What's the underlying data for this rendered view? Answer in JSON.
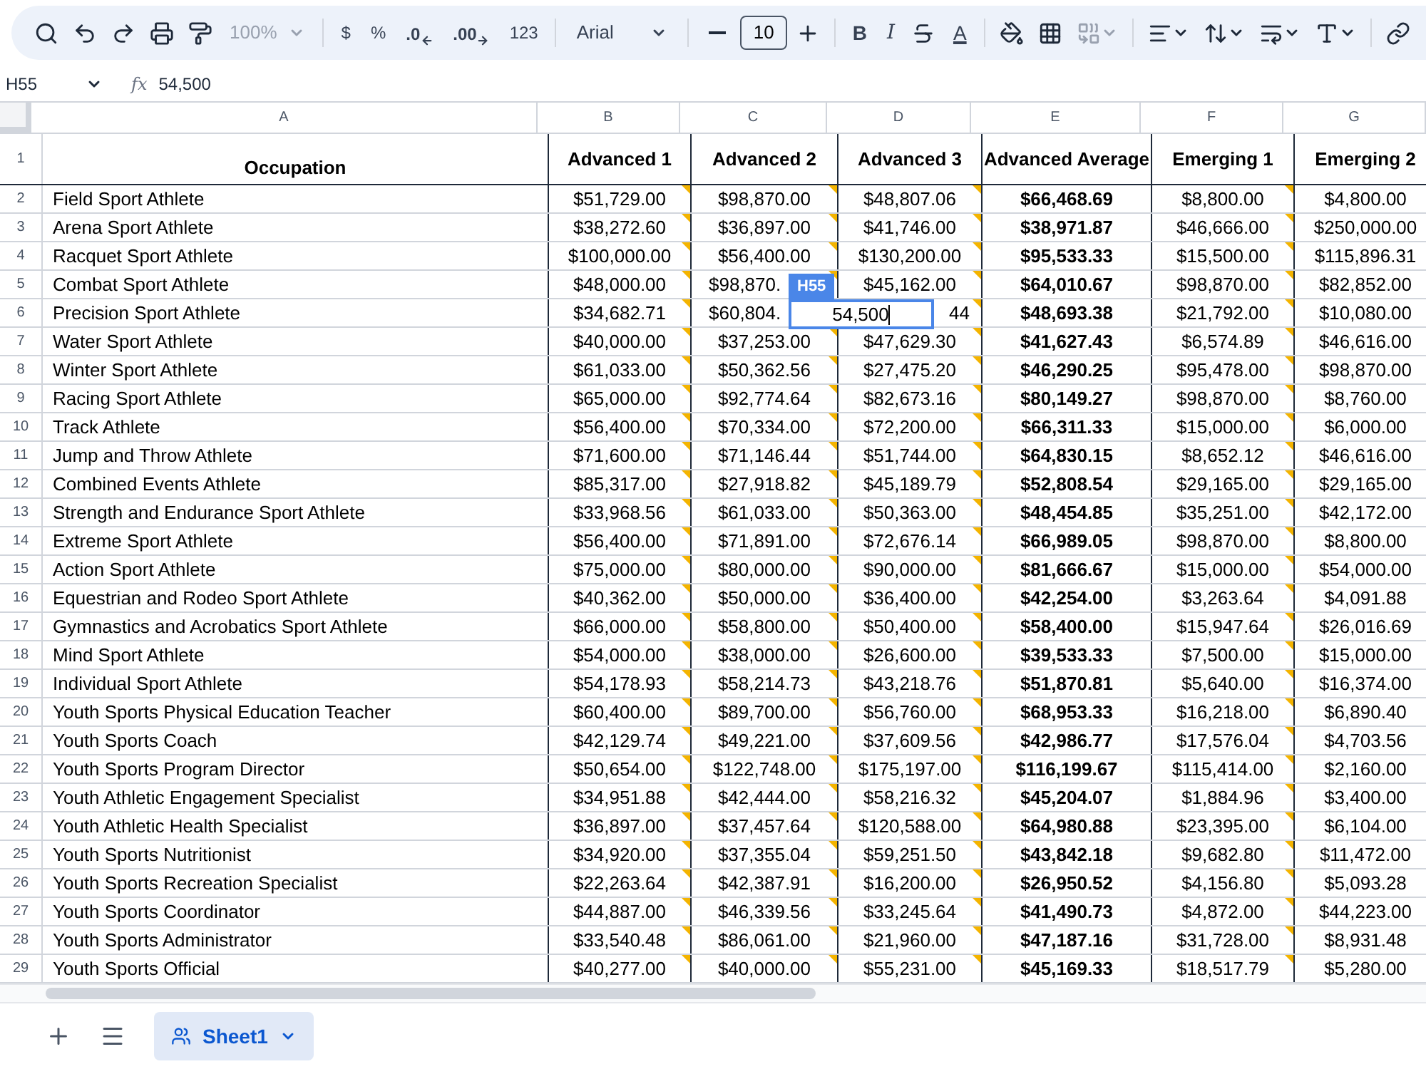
{
  "toolbar": [
    {
      "kind": "search"
    },
    {
      "kind": "undo"
    },
    {
      "kind": "redo"
    },
    {
      "kind": "print"
    },
    {
      "kind": "paint_format"
    },
    {
      "kind": "zoom",
      "label": "100%",
      "disabled": true
    },
    {
      "kind": "sep"
    },
    {
      "kind": "format",
      "label": "$"
    },
    {
      "kind": "format",
      "label": "%"
    },
    {
      "kind": "decimal_decrease",
      "label": ".0"
    },
    {
      "kind": "decimal_increase",
      "label": ".00"
    },
    {
      "kind": "format",
      "label": "123"
    },
    {
      "kind": "sep"
    },
    {
      "kind": "font",
      "label": "Arial"
    },
    {
      "kind": "sep"
    },
    {
      "kind": "minus"
    },
    {
      "kind": "font_size",
      "label": "10"
    },
    {
      "kind": "plus"
    },
    {
      "kind": "sep"
    },
    {
      "kind": "bold",
      "label": "B"
    },
    {
      "kind": "italic",
      "label": "I"
    },
    {
      "kind": "strikethrough"
    },
    {
      "kind": "text_color",
      "label": "A"
    },
    {
      "kind": "sep"
    },
    {
      "kind": "fill_color"
    },
    {
      "kind": "borders"
    },
    {
      "kind": "merge",
      "disabled": true
    },
    {
      "kind": "sep"
    },
    {
      "kind": "align"
    },
    {
      "kind": "vertical_align"
    },
    {
      "kind": "wrap"
    },
    {
      "kind": "rotate"
    },
    {
      "kind": "sep"
    },
    {
      "kind": "link"
    }
  ],
  "name_box": "H55",
  "formula_icon": "fx",
  "formula": "54,500",
  "columns": [
    {
      "letter": "A",
      "header": "Occupation",
      "bold_values": false,
      "notes": false
    },
    {
      "letter": "B",
      "header": "Advanced 1",
      "bold_values": false,
      "notes": true
    },
    {
      "letter": "C",
      "header": "Advanced 2",
      "bold_values": false,
      "notes": true
    },
    {
      "letter": "D",
      "header": "Advanced 3",
      "bold_values": false,
      "notes": true
    },
    {
      "letter": "E",
      "header": "Advanced Average",
      "bold_values": true,
      "notes": false
    },
    {
      "letter": "F",
      "header": "Emerging 1",
      "bold_values": false,
      "notes": true
    },
    {
      "letter": "G",
      "header": "Emerging 2",
      "bold_values": false
    }
  ],
  "header_row_number": "1",
  "rows": [
    {
      "number": "2",
      "cells": [
        "Field Sport Athlete",
        "$51,729.00",
        "$98,870.00",
        "$48,807.06",
        "$66,468.69",
        "$8,800.00",
        "$4,800.00"
      ]
    },
    {
      "number": "3",
      "cells": [
        "Arena Sport Athlete",
        "$38,272.60",
        "$36,897.00",
        "$41,746.00",
        "$38,971.87",
        "$46,666.00",
        "$250,000.00"
      ]
    },
    {
      "number": "4",
      "cells": [
        "Racquet Sport Athlete",
        "$100,000.00",
        "$56,400.00",
        "$130,200.00",
        "$95,533.33",
        "$15,500.00",
        "$115,896.31"
      ]
    },
    {
      "number": "5",
      "cells": [
        "Combat Sport Athlete",
        "$48,000.00",
        "$98,870.",
        "$45,162.00",
        "$64,010.67",
        "$98,870.00",
        "$82,852.00"
      ]
    },
    {
      "number": "6",
      "cells": [
        "Precision Sport Athlete",
        "$34,682.71",
        "$60,804.",
        "44",
        "$48,693.38",
        "$21,792.00",
        "$10,080.00"
      ]
    },
    {
      "number": "7",
      "cells": [
        "Water Sport Athlete",
        "$40,000.00",
        "$37,253.00",
        "$47,629.30",
        "$41,627.43",
        "$6,574.89",
        "$46,616.00"
      ]
    },
    {
      "number": "8",
      "cells": [
        "Winter Sport Athlete",
        "$61,033.00",
        "$50,362.56",
        "$27,475.20",
        "$46,290.25",
        "$95,478.00",
        "$98,870.00"
      ]
    },
    {
      "number": "9",
      "cells": [
        "Racing Sport Athlete",
        "$65,000.00",
        "$92,774.64",
        "$82,673.16",
        "$80,149.27",
        "$98,870.00",
        "$8,760.00"
      ]
    },
    {
      "number": "10",
      "cells": [
        "Track Athlete",
        "$56,400.00",
        "$70,334.00",
        "$72,200.00",
        "$66,311.33",
        "$15,000.00",
        "$6,000.00"
      ]
    },
    {
      "number": "11",
      "cells": [
        "Jump and Throw Athlete",
        "$71,600.00",
        "$71,146.44",
        "$51,744.00",
        "$64,830.15",
        "$8,652.12",
        "$46,616.00"
      ]
    },
    {
      "number": "12",
      "cells": [
        "Combined Events Athlete",
        "$85,317.00",
        "$27,918.82",
        "$45,189.79",
        "$52,808.54",
        "$29,165.00",
        "$29,165.00"
      ]
    },
    {
      "number": "13",
      "cells": [
        "Strength and Endurance Sport Athlete",
        "$33,968.56",
        "$61,033.00",
        "$50,363.00",
        "$48,454.85",
        "$35,251.00",
        "$42,172.00"
      ]
    },
    {
      "number": "14",
      "cells": [
        "Extreme Sport Athlete",
        "$56,400.00",
        "$71,891.00",
        "$72,676.14",
        "$66,989.05",
        "$98,870.00",
        "$8,800.00"
      ]
    },
    {
      "number": "15",
      "cells": [
        "Action Sport Athlete",
        "$75,000.00",
        "$80,000.00",
        "$90,000.00",
        "$81,666.67",
        "$15,000.00",
        "$54,000.00"
      ]
    },
    {
      "number": "16",
      "cells": [
        "Equestrian and Rodeo Sport Athlete",
        "$40,362.00",
        "$50,000.00",
        "$36,400.00",
        "$42,254.00",
        "$3,263.64",
        "$4,091.88"
      ]
    },
    {
      "number": "17",
      "cells": [
        "Gymnastics and Acrobatics Sport Athlete",
        "$66,000.00",
        "$58,800.00",
        "$50,400.00",
        "$58,400.00",
        "$15,947.64",
        "$26,016.69"
      ]
    },
    {
      "number": "18",
      "cells": [
        "Mind Sport Athlete",
        "$54,000.00",
        "$38,000.00",
        "$26,600.00",
        "$39,533.33",
        "$7,500.00",
        "$15,000.00"
      ]
    },
    {
      "number": "19",
      "cells": [
        "Individual Sport Athlete",
        "$54,178.93",
        "$58,214.73",
        "$43,218.76",
        "$51,870.81",
        "$5,640.00",
        "$16,374.00"
      ]
    },
    {
      "number": "20",
      "cells": [
        "Youth Sports Physical Education Teacher",
        "$60,400.00",
        "$89,700.00",
        "$56,760.00",
        "$68,953.33",
        "$16,218.00",
        "$6,890.40"
      ]
    },
    {
      "number": "21",
      "cells": [
        "Youth Sports Coach",
        "$42,129.74",
        "$49,221.00",
        "$37,609.56",
        "$42,986.77",
        "$17,576.04",
        "$4,703.56"
      ]
    },
    {
      "number": "22",
      "cells": [
        "Youth Sports Program Director",
        "$50,654.00",
        "$122,748.00",
        "$175,197.00",
        "$116,199.67",
        "$115,414.00",
        "$2,160.00"
      ]
    },
    {
      "number": "23",
      "cells": [
        "Youth Athletic Engagement Specialist",
        "$34,951.88",
        "$42,444.00",
        "$58,216.32",
        "$45,204.07",
        "$1,884.96",
        "$3,400.00"
      ]
    },
    {
      "number": "24",
      "cells": [
        "Youth Athletic Health Specialist",
        "$36,897.00",
        "$37,457.64",
        "$120,588.00",
        "$64,980.88",
        "$23,395.00",
        "$6,104.00"
      ]
    },
    {
      "number": "25",
      "cells": [
        "Youth Sports Nutritionist",
        "$34,920.00",
        "$37,355.04",
        "$59,251.50",
        "$43,842.18",
        "$9,682.80",
        "$11,472.00"
      ]
    },
    {
      "number": "26",
      "cells": [
        "Youth Sports Recreation Specialist",
        "$22,263.64",
        "$42,387.91",
        "$16,200.00",
        "$26,950.52",
        "$4,156.80",
        "$5,093.28"
      ]
    },
    {
      "number": "27",
      "cells": [
        "Youth Sports Coordinator",
        "$44,887.00",
        "$46,339.56",
        "$33,245.64",
        "$41,490.73",
        "$4,872.00",
        "$44,223.00"
      ]
    },
    {
      "number": "28",
      "cells": [
        "Youth Sports Administrator",
        "$33,540.48",
        "$86,061.00",
        "$21,960.00",
        "$47,187.16",
        "$31,728.00",
        "$8,931.48"
      ]
    },
    {
      "number": "29",
      "cells": [
        "Youth Sports Official",
        "$40,277.00",
        "$40,000.00",
        "$55,231.00",
        "$45,169.33",
        "$18,517.79",
        "$5,280.00"
      ]
    }
  ],
  "editor": {
    "cell_ref": "H55",
    "value": "54,500"
  },
  "sheet_tabs": [
    {
      "label": "Sheet1",
      "selected": true
    }
  ]
}
